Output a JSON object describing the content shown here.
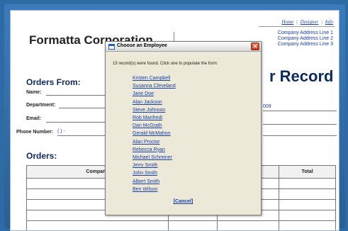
{
  "header": {
    "links": [
      "Home",
      "Designer",
      "Info"
    ],
    "company_name": "Formatta Corporation",
    "address_lines": [
      "Company Address Line 1",
      "Company Address Line 2",
      "Company Address Line 3"
    ],
    "doc_title_fragment": "r Record"
  },
  "orders_from": {
    "heading": "Orders From:",
    "name_label": "Name:",
    "department_label": "Department:",
    "email_label": "Email:",
    "phone_label": "Phone Number:",
    "phone_value": "(   )   -",
    "date_fragment": "009"
  },
  "orders": {
    "heading": "Orders:",
    "columns": [
      "Company",
      "",
      "",
      "Total"
    ]
  },
  "dialog": {
    "title": "Choose an Employee",
    "close_glyph": "✕",
    "message": "15 record(s) were found. Click one to populate the form:",
    "employees": [
      "Kristen Campbell",
      "Susanna Cleveland",
      "Jane Doe",
      "Alan Jackson",
      "Steve Johnson",
      "Rob Manfredi",
      "Dan McGrath",
      "Gerald McMahon",
      "Alan Proctor",
      "Rebecca Ryan",
      "Michael Schreiner",
      "Jerry Smith",
      "John Smith",
      "Albert Smith",
      "Ben Wilson"
    ],
    "cancel_label": "[Cancel]"
  },
  "colors": {
    "background": "#2e6aa4",
    "link": "#1a3ea8",
    "heading": "#0d2a5c",
    "dialog_bg": "#ece9d8",
    "close_button": "#c1391d"
  }
}
